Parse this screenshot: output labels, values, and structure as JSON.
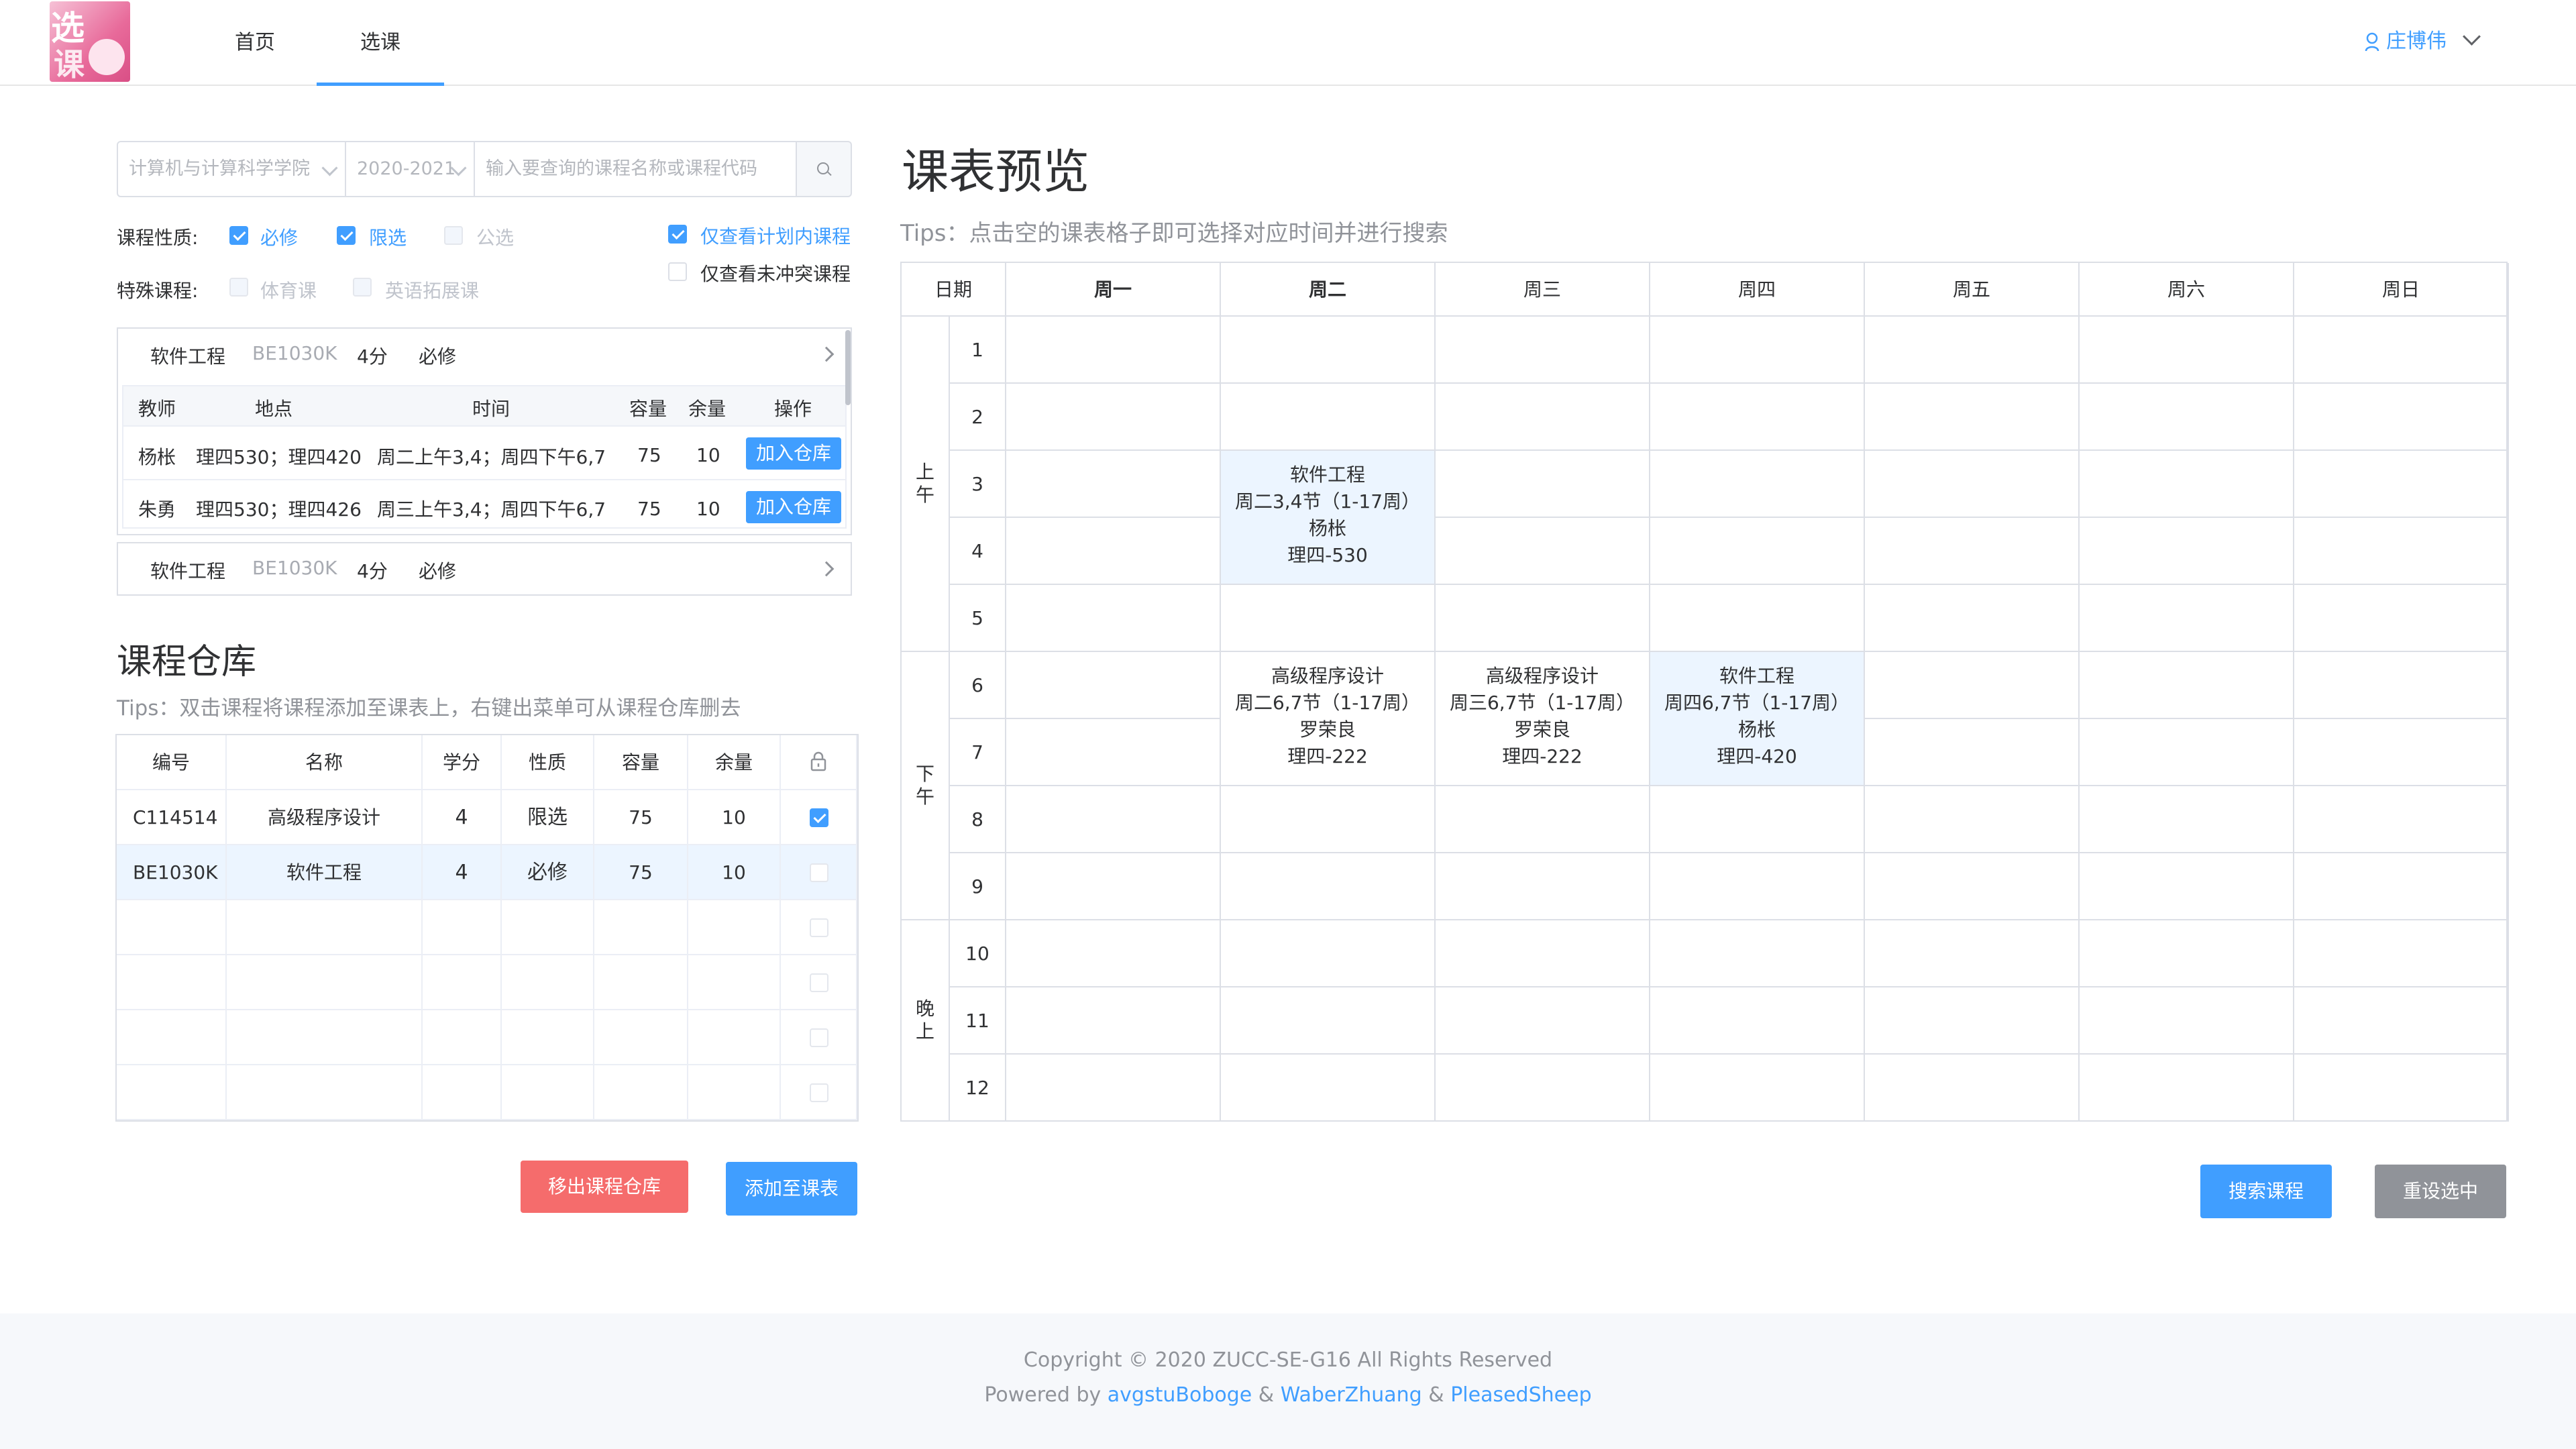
{
  "header": {
    "nav": [
      "首页",
      "选课"
    ],
    "active_nav": "选课",
    "user_name": "庄博伟"
  },
  "search": {
    "college": "计算机与计算科学学院",
    "year": "2020-2021",
    "placeholder": "输入要查询的课程名称或课程代码"
  },
  "filters": {
    "nature_label": "课程性质:",
    "nature_options": [
      {
        "label": "必修",
        "checked": true,
        "disabled": false
      },
      {
        "label": "限选",
        "checked": true,
        "disabled": false
      },
      {
        "label": "公选",
        "checked": false,
        "disabled": true
      }
    ],
    "special_label": "特殊课程:",
    "special_options": [
      {
        "label": "体育课",
        "checked": false,
        "disabled": true
      },
      {
        "label": "英语拓展课",
        "checked": false,
        "disabled": true
      }
    ],
    "plan_only": {
      "label": "仅查看计划内课程",
      "checked": true
    },
    "no_conflict": {
      "label": "仅查看未冲突课程",
      "checked": false
    }
  },
  "course_results": [
    {
      "name": "软件工程",
      "code": "BE1030K",
      "credit": "4分",
      "type": "必修",
      "expanded": true,
      "columns": [
        "教师",
        "地点",
        "时间",
        "容量",
        "余量",
        "操作"
      ],
      "rows": [
        {
          "teacher": "杨枨",
          "place": "理四530；理四420",
          "time": "周二上午3,4；周四下午6,7",
          "capacity": "75",
          "remain": "10",
          "action": "加入仓库"
        },
        {
          "teacher": "朱勇",
          "place": "理四530；理四426",
          "time": "周三上午3,4；周四下午6,7",
          "capacity": "75",
          "remain": "10",
          "action": "加入仓库"
        }
      ]
    },
    {
      "name": "软件工程",
      "code": "BE1030K",
      "credit": "4分",
      "type": "必修",
      "expanded": false
    }
  ],
  "warehouse": {
    "title": "课程仓库",
    "tips": "Tips：双击课程将课程添加至课表上，右键出菜单可从课程仓库删去",
    "columns": [
      "编号",
      "名称",
      "学分",
      "性质",
      "容量",
      "余量"
    ],
    "lock_icon": "lock-icon",
    "rows": [
      {
        "code": "C114514",
        "name": "高级程序设计",
        "credit": "4",
        "type": "限选",
        "capacity": "75",
        "remain": "10",
        "checked": true
      },
      {
        "code": "BE1030K",
        "name": "软件工程",
        "credit": "4",
        "type": "必修",
        "capacity": "75",
        "remain": "10",
        "checked": false
      }
    ],
    "remove_button": "移出课程仓库",
    "add_button": "添加至课表"
  },
  "schedule": {
    "title": "课表预览",
    "tips": "Tips：点击空的课表格子即可选择对应时间并进行搜索",
    "date_label": "日期",
    "days": [
      "周一",
      "周二",
      "周三",
      "周四",
      "周五",
      "周六",
      "周日"
    ],
    "bold_days": [
      "周一",
      "周二"
    ],
    "periods": [
      "1",
      "2",
      "3",
      "4",
      "5",
      "6",
      "7",
      "8",
      "9",
      "10",
      "11",
      "12"
    ],
    "sections": [
      {
        "label": "上午"
      },
      {
        "label": "下午"
      },
      {
        "label": "晚上"
      }
    ],
    "courses": [
      {
        "day": 1,
        "start": 3,
        "end": 4,
        "lines": [
          "软件工程",
          "周二3,4节（1-17周）",
          "杨枨",
          "理四-530"
        ],
        "highlight": true
      },
      {
        "day": 1,
        "start": 6,
        "end": 7,
        "lines": [
          "高级程序设计",
          "周二6,7节（1-17周）",
          "罗荣良",
          "理四-222"
        ],
        "highlight": false
      },
      {
        "day": 2,
        "start": 6,
        "end": 7,
        "lines": [
          "高级程序设计",
          "周三6,7节（1-17周）",
          "罗荣良",
          "理四-222"
        ],
        "highlight": false
      },
      {
        "day": 3,
        "start": 6,
        "end": 7,
        "lines": [
          "软件工程",
          "周四6,7节（1-17周）",
          "杨枨",
          "理四-420"
        ],
        "highlight": true
      }
    ],
    "search_button": "搜索课程",
    "reset_button": "重设选中"
  },
  "footer": {
    "copyright": "Copyright © 2020 ZUCC-SE-G16 All Rights Reserved",
    "powered_by": "Powered by",
    "author1": "avgstuBoboge",
    "amp": "&",
    "author2": "WaberZhuang",
    "author3": "PleasedSheep"
  },
  "colors": {
    "primary": "#409eff",
    "danger": "#f56c6c",
    "gray_button": "#909399",
    "highlight": "#ecf5ff"
  }
}
